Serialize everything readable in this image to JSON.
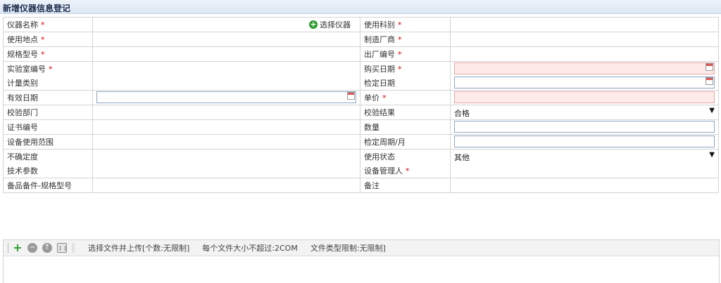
{
  "page": {
    "title": "新增仪器信息登记"
  },
  "colors": {
    "required": "#dd0000",
    "invalid_bg": "#ffeaea",
    "input_border": "#8fa7c6"
  },
  "form": {
    "required_mark": "*",
    "pick_instrument_label": "选择仪器",
    "rows": [
      {
        "l": "仪器名称",
        "l_req": true,
        "r": "使用科别",
        "r_req": true
      },
      {
        "l": "使用地点",
        "l_req": true,
        "r": "制造厂商",
        "r_req": true
      },
      {
        "l": "规格型号",
        "l_req": true,
        "r": "出厂编号",
        "r_req": true
      },
      {
        "l": "实验室编号",
        "l_req": true,
        "r": "购买日期",
        "r_req": true
      },
      {
        "l": "计量类别",
        "r": "检定日期"
      },
      {
        "l": "有效日期",
        "r": "单价",
        "r_req": true
      },
      {
        "l": "校验部门",
        "r": "校验结果"
      },
      {
        "l": "证书编号",
        "r": "数量"
      },
      {
        "l": "设备使用范围",
        "r": "检定周期/月"
      },
      {
        "l": "不确定度",
        "r": "使用状态"
      },
      {
        "l": "技术参数",
        "r": "设备管理人",
        "r_req": true
      },
      {
        "l": "备品备件-规格型号",
        "r": "备注"
      }
    ],
    "calibration_result": {
      "selected": "合格"
    },
    "usage_status": {
      "selected": "其他"
    }
  },
  "upload": {
    "hint": "选择文件并上传[个数:无限制]",
    "size_limit": "每个文件大小不超过:2COM",
    "type_limit": "文件类型限制:无限制]"
  },
  "icons": {
    "pick": "plus-circle-icon",
    "date": "calendar-icon",
    "dropdown": "triangle-down-icon",
    "add": "plus-icon",
    "remove": "minus-circle-icon",
    "upload": "arrow-up-circle-icon",
    "delete": "trash-icon"
  }
}
